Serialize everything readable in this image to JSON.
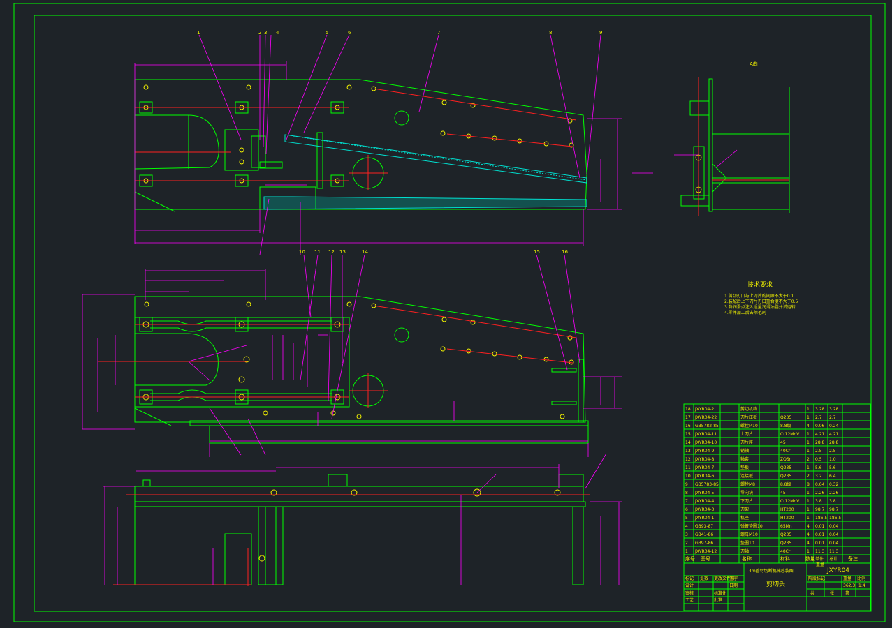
{
  "drawing": {
    "view_label": "A向",
    "tech_requirements_title": "技术要求",
    "tech_requirements": [
      "1.剪切刃口与上刀片的间隙不大于0.1",
      "2.装配后上下刀片刃口重合度不大于0.5",
      "3.各润滑点注入适量润滑油脂并试运转",
      "4.零件加工后去除毛刺"
    ],
    "part_balloons_top": [
      "1",
      "2",
      "3",
      "4",
      "5",
      "6",
      "7",
      "8",
      "9"
    ],
    "part_balloons_mid": [
      "10",
      "11",
      "12",
      "13",
      "14",
      "15",
      "16"
    ]
  },
  "bom": {
    "headers": [
      "序号",
      "图号",
      "名称",
      "数量",
      "材料",
      "单件",
      "总计",
      "备注"
    ],
    "header_weight": "重量",
    "rows": [
      [
        "18",
        "JXYR04-2",
        "剪切机构",
        "1",
        "",
        "3.28",
        "3.28"
      ],
      [
        "17",
        "JXYR04-22",
        "刀片压板",
        "1",
        "Q235",
        "2.7",
        "2.7"
      ],
      [
        "16",
        "GB5782-85",
        "螺栓M10",
        "4",
        "8.8级",
        "0.06",
        "0.24"
      ],
      [
        "15",
        "JXYR04-11",
        "上刀片",
        "1",
        "Cr12MoV",
        "4.21",
        "4.21"
      ],
      [
        "14",
        "JXYR04-10",
        "刀片座",
        "1",
        "45",
        "28.8",
        "28.8"
      ],
      [
        "13",
        "JXYR04-9",
        "销轴",
        "1",
        "40Cr",
        "2.5",
        "2.5"
      ],
      [
        "12",
        "JXYR04-8",
        "轴套",
        "2",
        "ZQSn",
        "0.5",
        "1.0"
      ],
      [
        "11",
        "JXYR04-7",
        "垫板",
        "1",
        "Q235",
        "5.6",
        "5.6"
      ],
      [
        "10",
        "JXYR04-6",
        "连接板",
        "2",
        "Q235",
        "3.2",
        "6.4"
      ],
      [
        "9",
        "GB5783-85",
        "螺栓M8",
        "8",
        "8.8级",
        "0.04",
        "0.32"
      ],
      [
        "8",
        "JXYR04-5",
        "导向块",
        "1",
        "45",
        "2.26",
        "2.26"
      ],
      [
        "7",
        "JXYR04-4",
        "下刀片",
        "1",
        "Cr12MoV",
        "3.8",
        "3.8"
      ],
      [
        "6",
        "JXYR04-3",
        "刀架",
        "1",
        "HT200",
        "98.7",
        "98.7"
      ],
      [
        "5",
        "JXYR04-1",
        "机座",
        "1",
        "HT200",
        "186.5",
        "186.5"
      ],
      [
        "4",
        "GB93-87",
        "弹簧垫圈10",
        "4",
        "65Mn",
        "0.01",
        "0.04"
      ],
      [
        "3",
        "GB41-86",
        "螺母M10",
        "4",
        "Q235",
        "0.01",
        "0.04"
      ],
      [
        "2",
        "GB97-86",
        "垫圈10",
        "4",
        "Q235",
        "0.01",
        "0.04"
      ],
      [
        "1",
        "JXYR04-12",
        "刀轴",
        "1",
        "40Cr",
        "11.3",
        "11.3"
      ]
    ]
  },
  "title_block": {
    "drawing_no": "JXYR04",
    "project_title": "4m管材切断机械总装图",
    "part_name": "剪切头",
    "fields": {
      "mark": "标记",
      "count": "处数",
      "change_doc": "更改文件号",
      "signature": "签字",
      "date": "日期",
      "designer": "设计",
      "checker": "审核",
      "craft": "工艺",
      "standardization": "标准化",
      "approval": "批准",
      "stage_mark": "阶段标记",
      "weight": "重量",
      "scale": "比例"
    },
    "weight_value": "362.3",
    "scale_value": "1:4",
    "sheet_total": "共",
    "sheet_unit": "张",
    "sheet_no": "第"
  },
  "colors": {
    "background": "#1e2328",
    "outline": "#00ff00",
    "dimension": "#ff00ff",
    "centerline": "#ff2020",
    "text": "#f0f000",
    "hatch": "#00e0d0",
    "table": "#00ff00"
  }
}
